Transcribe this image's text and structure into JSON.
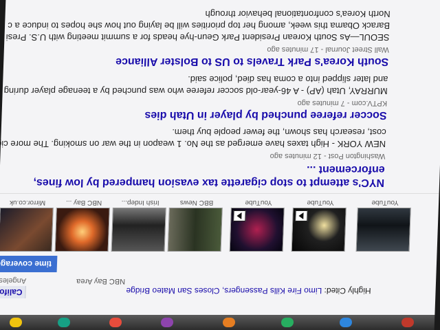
{
  "header": {
    "section_tab": "California",
    "section_sub": "Angeles Times",
    "cited_prefix": "Highly Cited:",
    "cited_link": "Limo Fire Kills Passengers, Closes San Mateo Bridge",
    "cited_source": "NBC Bay Area",
    "coverage_button": "time coverage"
  },
  "thumbnails": [
    {
      "source": "Mirror.co.uk",
      "video": false
    },
    {
      "source": "NBC Bay ...",
      "video": false
    },
    {
      "source": "Irish Indep...",
      "video": false
    },
    {
      "source": "BBC News",
      "video": false
    },
    {
      "source": "YouTube",
      "video": true
    },
    {
      "source": "YouTube",
      "video": true
    },
    {
      "source": "YouTube",
      "video": false
    }
  ],
  "articles": [
    {
      "title": "NYC's attempt to stop cigarette tax evasion hampered by low fines,",
      "title_cont": "enforcement ...",
      "source": "Washington Post - 12 minutes ago",
      "snippet": [
        "NEW YORK - High taxes have emerged as the No. 1 weapon in the war on smoking. The more cig",
        "cost, research has shown, the fewer people buy them."
      ]
    },
    {
      "title": "Soccer referee punched by player in Utah dies",
      "source": "KPTV.com - 7 minutes ago",
      "snippet": [
        "MURRAY, Utah (AP) - A 46-year-old soccer referee who was punched by a teenage player during",
        "and later slipped into a coma has died, police said."
      ]
    },
    {
      "title": "South Korea's Park Travels to US to Bolster Alliance",
      "source": "Wall Street Journal - 17 minutes ago",
      "snippet": [
        "SEOUL—As South Korean President Park Geun-hye heads for a summit meeting with U.S. Presi",
        "Barack Obama this week, among her top priorities will be laying out how she hopes to induce a c",
        "North Korea's confrontational behavior through"
      ]
    }
  ],
  "dock_colors": [
    "#c0392b",
    "#2e86de",
    "#27ae60",
    "#e67e22",
    "#8e44ad",
    "#e74c3c",
    "#16a085",
    "#f1c40f"
  ]
}
